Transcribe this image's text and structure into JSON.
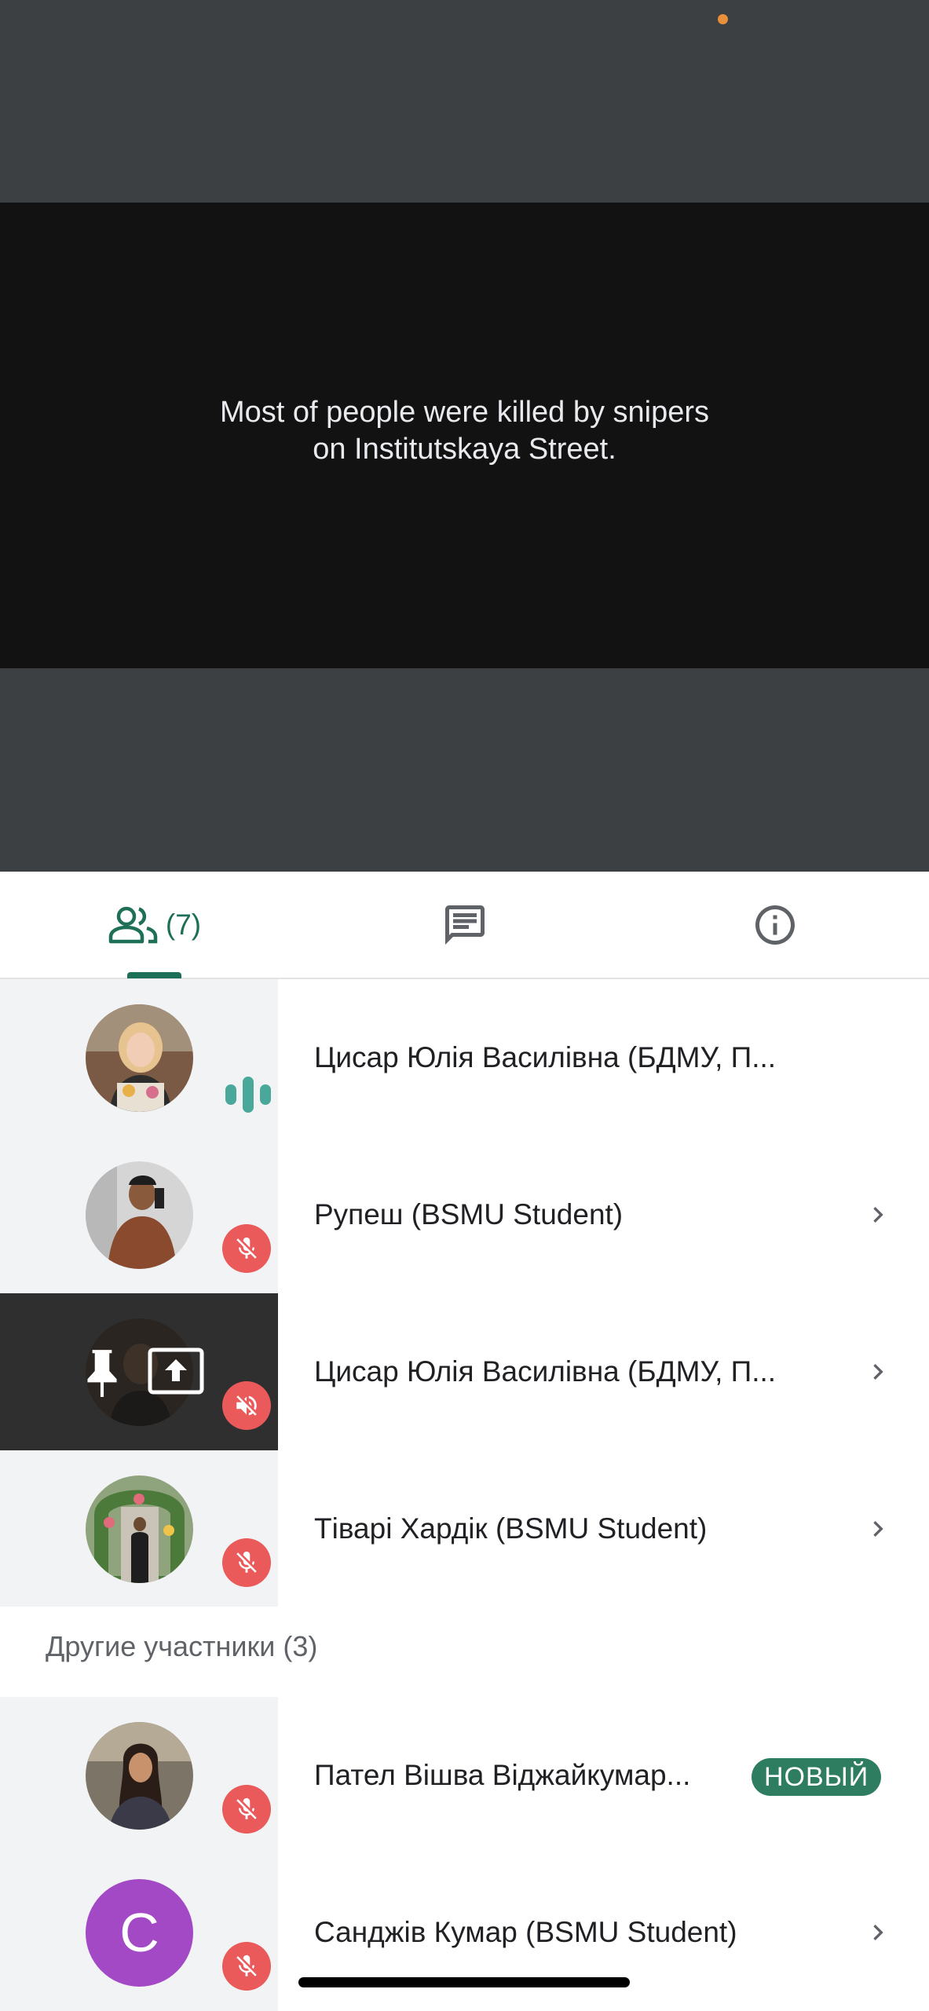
{
  "video": {
    "caption_line1": "Most of people were killed by snipers",
    "caption_line2": "on Institutskaya Street."
  },
  "tabs": {
    "people_icon": "people-icon",
    "people_count": "(7)",
    "chat_icon": "chat-icon",
    "info_icon": "info-icon",
    "active": "people"
  },
  "participants": [
    {
      "name": "Цисар Юлія Василівна (БДМУ, П...",
      "status": "speaking"
    },
    {
      "name": "Рупеш (BSMU Student)",
      "status": "muted"
    },
    {
      "name": "Цисар Юлія Василівна (БДМУ, П...",
      "status": "presenting-muted"
    },
    {
      "name": "Тіварі Хардік (BSMU Student)",
      "status": "muted"
    }
  ],
  "other_section": {
    "title": "Другие участники (3)",
    "participants": [
      {
        "name": "Пател Вішва Віджайкумар...",
        "badge": "НОВЫЙ",
        "status": "muted"
      },
      {
        "name": "Санджів Кумар (BSMU Student)",
        "avatar_letter": "C",
        "status": "muted"
      }
    ]
  },
  "colors": {
    "accent": "#1e6f57",
    "mute_red": "#ea5a5a",
    "badge_green": "#2e7d60",
    "avatar_purple": "#a349c6"
  }
}
